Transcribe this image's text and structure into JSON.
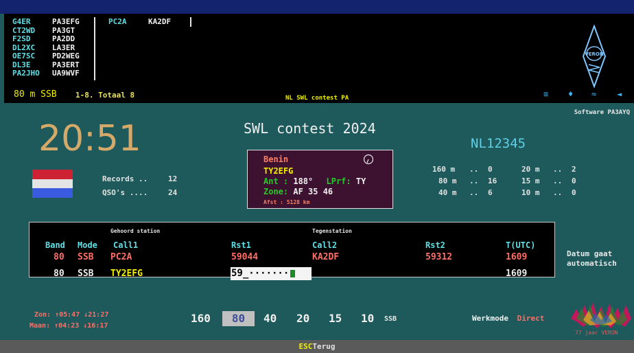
{
  "spotted": {
    "left_col": [
      "G4ER",
      "CT2WD",
      "F2SD",
      "DL2XC",
      "OE7SC",
      "DL3E",
      "PA2JHO"
    ],
    "mid_col": [
      "PA3EFG",
      "PA3GT",
      "PA2DD",
      "LA3ER",
      "PD2WEG",
      "PA3ERT",
      "UA9WVF"
    ],
    "right_calls": [
      "PC2A",
      "KA2DF"
    ]
  },
  "status": {
    "band": "80 m SSB",
    "range": "1-8. Totaal 8",
    "contest_small": "NL SWL contest PA",
    "nav_icons": [
      "≡",
      "♦",
      "≈",
      "◄"
    ]
  },
  "software": "Software PA3AYQ",
  "clock": "20:51",
  "title": "SWL contest 2024",
  "callsign": "NL12345",
  "flag_colors": [
    "#cc2233",
    "#e4e4e4",
    "#3a5bdf"
  ],
  "stats": {
    "records_label": "Records ..",
    "records_value": "12",
    "qsos_label": "QSO's ....",
    "qsos_value": "24"
  },
  "info": {
    "country": "Benin",
    "call": "TY2EFG",
    "ant_label": "Ant :",
    "ant_value": "188°",
    "lprf_label": "LPrf:",
    "lprf_value": "TY",
    "zone_label": "Zone:",
    "zone_value": "AF 35 46",
    "dist": "Afst :  5128 km"
  },
  "band_stats": [
    {
      "band": "160 m",
      "dots": "..",
      "count": "0"
    },
    {
      "band": "80 m",
      "dots": "..",
      "count": "16"
    },
    {
      "band": "40 m",
      "dots": "..",
      "count": "6"
    },
    {
      "band": "20 m",
      "dots": "..",
      "count": "2"
    },
    {
      "band": "15 m",
      "dots": "..",
      "count": "0"
    },
    {
      "band": "10 m",
      "dots": "..",
      "count": "0"
    }
  ],
  "log": {
    "heard_header": "Gehoord station",
    "counter_header": "Tegenstation",
    "columns": [
      "Band",
      "Mode",
      "Call1",
      "Rst1",
      "Call2",
      "Rst2",
      "T(UTC)"
    ],
    "rows": [
      {
        "band": "80",
        "mode": "SSB",
        "call1": "PC2A",
        "rst1": "59044",
        "call2": "KA2DF",
        "rst2": "59312",
        "time": "1609"
      },
      {
        "band": "80",
        "mode": "SSB",
        "call1": "TY2EFG",
        "rst1": "59_·······",
        "time": "1609"
      }
    ]
  },
  "datum": [
    "Datum gaat",
    "automatisch"
  ],
  "sun": "Zon: ↑05:47 ↓21:27",
  "moon": "Maan: ↑04:23 ↓16:17",
  "bands": [
    "160",
    "80",
    "40",
    "20",
    "15",
    "10"
  ],
  "selected_band": "80",
  "mode_small": "SSB",
  "werkmode_label": "Werkmode",
  "werkmode_value": "Direct",
  "logo_caption": "77 jaar VERON",
  "veron_text": "VERON",
  "esc_key": "ESC",
  "esc_label": "Terug"
}
